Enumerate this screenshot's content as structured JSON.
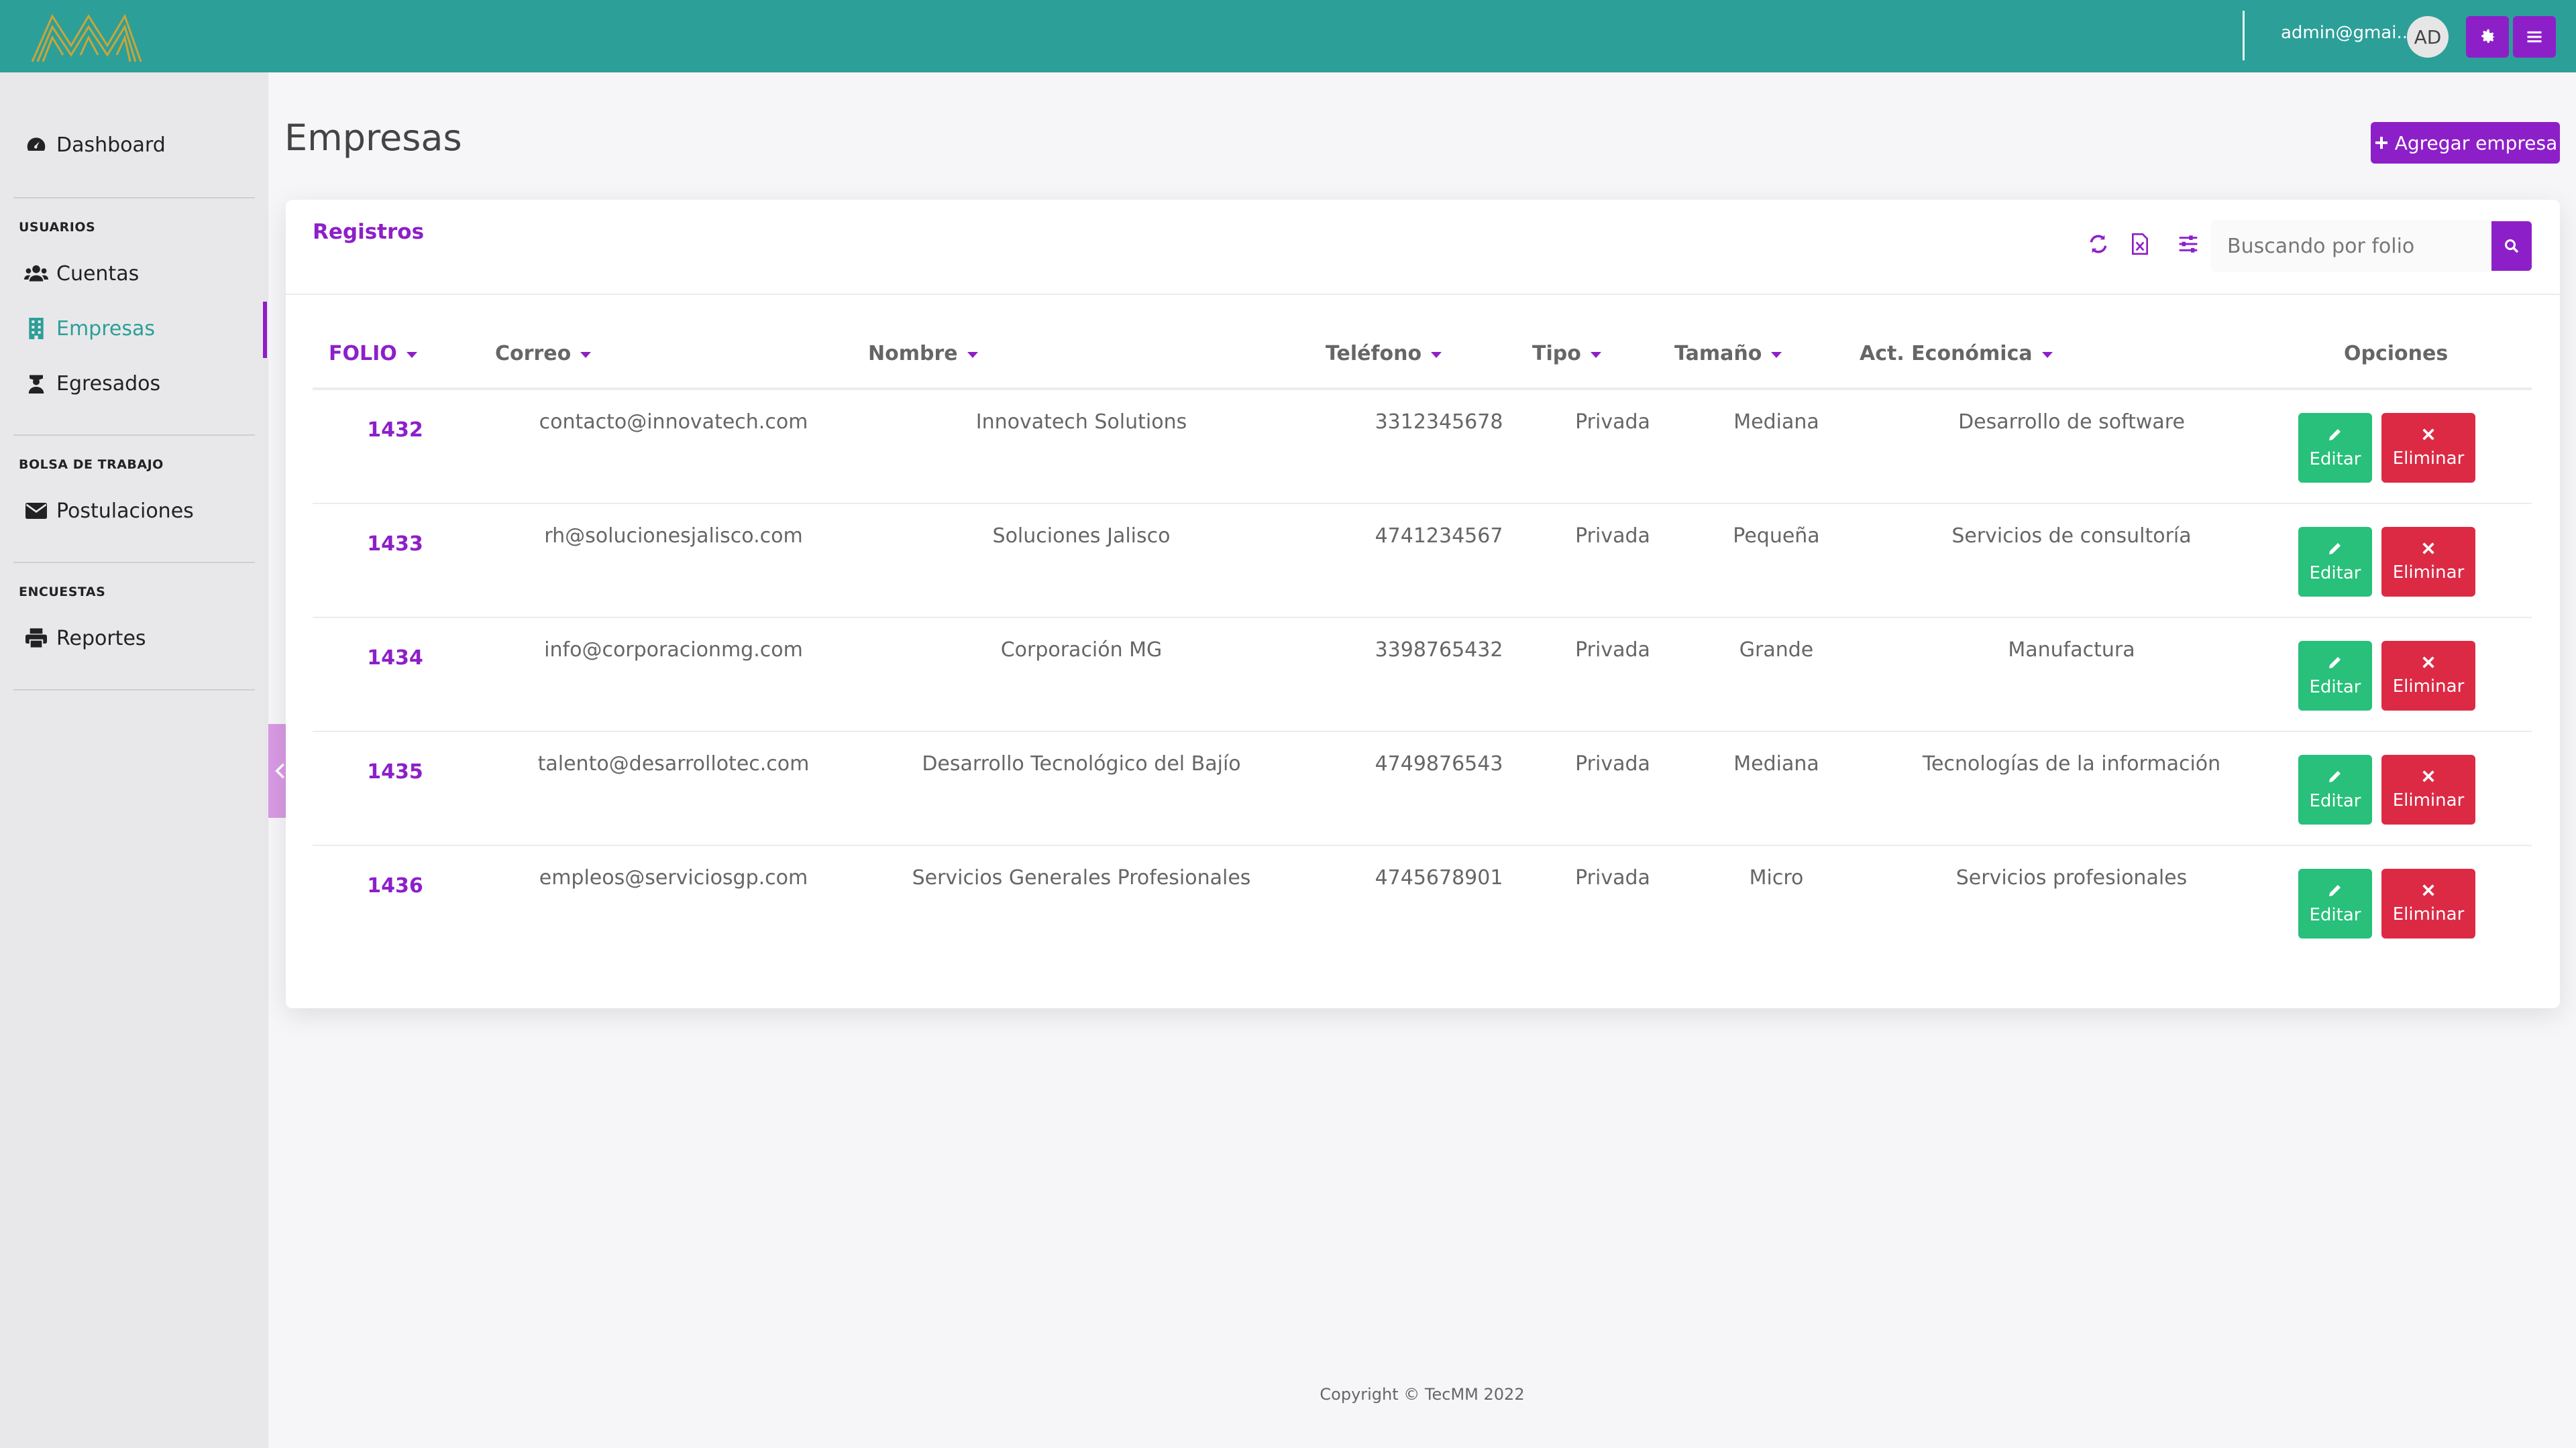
{
  "colors": {
    "topbar": "#2c9f98",
    "accent": "#8d1fc8",
    "edit": "#28c07a",
    "delete": "#dc2a45",
    "active_nav": "#2c9f98"
  },
  "header": {
    "user_email": "admin@gmai...",
    "avatar_initials": "AD",
    "settings_icon": "gear-icon",
    "menu_icon": "hamburger-icon"
  },
  "sidebar": {
    "dashboard": "Dashboard",
    "sections": [
      {
        "title": "USUARIOS",
        "items": [
          "Cuentas",
          "Empresas",
          "Egresados"
        ]
      },
      {
        "title": "BOLSA DE TRABAJO",
        "items": [
          "Postulaciones"
        ]
      },
      {
        "title": "ENCUESTAS",
        "items": [
          "Reportes"
        ]
      }
    ],
    "active_item": "Empresas"
  },
  "main": {
    "title": "Empresas",
    "add_button": "Agregar empresa",
    "card_title": "Registros",
    "search_placeholder": "Buscando por folio",
    "columns": [
      "FOLIO",
      "Correo",
      "Nombre",
      "Teléfono",
      "Tipo",
      "Tamaño",
      "Act. Económica",
      "Opciones"
    ],
    "edit_label": "Editar",
    "delete_label": "Eliminar",
    "rows": [
      {
        "folio": "1432",
        "correo": "contacto@innovatech.com",
        "nombre": "Innovatech Solutions",
        "telefono": "3312345678",
        "tipo": "Privada",
        "tamano": "Mediana",
        "actividad": "Desarrollo de software"
      },
      {
        "folio": "1433",
        "correo": "rh@solucionesjalisco.com",
        "nombre": "Soluciones Jalisco",
        "telefono": "4741234567",
        "tipo": "Privada",
        "tamano": "Pequeña",
        "actividad": "Servicios de consultoría"
      },
      {
        "folio": "1434",
        "correo": "info@corporacionmg.com",
        "nombre": "Corporación MG",
        "telefono": "3398765432",
        "tipo": "Privada",
        "tamano": "Grande",
        "actividad": "Manufactura"
      },
      {
        "folio": "1435",
        "correo": "talento@desarrollotec.com",
        "nombre": "Desarrollo Tecnológico del Bajío",
        "telefono": "4749876543",
        "tipo": "Privada",
        "tamano": "Mediana",
        "actividad": "Tecnologías de la información"
      },
      {
        "folio": "1436",
        "correo": "empleos@serviciosgp.com",
        "nombre": "Servicios Generales Profesionales",
        "telefono": "4745678901",
        "tipo": "Privada",
        "tamano": "Micro",
        "actividad": "Servicios profesionales"
      }
    ]
  },
  "footer": {
    "copyright": "Copyright © TecMM 2022"
  }
}
